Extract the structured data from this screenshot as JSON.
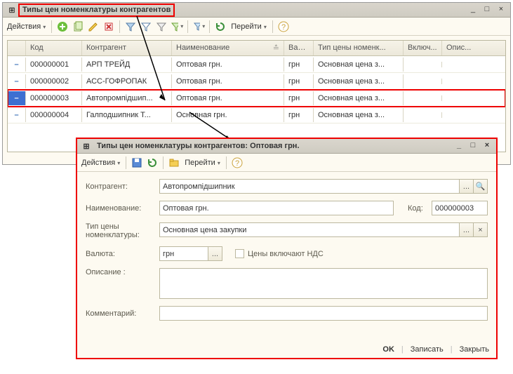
{
  "win1": {
    "title": "Типы цен номенклатуры контрагентов",
    "toolbar": {
      "actions": "Действия",
      "goto": "Перейти"
    },
    "sys": {
      "min": "_",
      "max": "□",
      "close": "×"
    },
    "cols": {
      "code": "Код",
      "counterparty": "Контрагент",
      "name": "Наименование",
      "currency": "Вал...",
      "pricetype": "Тип цены номенк...",
      "incl": "Включ...",
      "desc": "Опис..."
    },
    "rows": [
      {
        "code": "000000001",
        "counterparty": "АРП ТРЕЙД",
        "name": "Оптовая грн.",
        "currency": "грн",
        "pricetype": "Основная цена з...",
        "incl": "",
        "desc": "",
        "selected": false
      },
      {
        "code": "000000002",
        "counterparty": "АСС-ГОФРОПАК",
        "name": "Оптовая грн.",
        "currency": "грн",
        "pricetype": "Основная цена з...",
        "incl": "",
        "desc": "",
        "selected": false
      },
      {
        "code": "000000003",
        "counterparty": "Автопромпідшип...",
        "name": "Оптовая грн.",
        "currency": "грн",
        "pricetype": "Основная цена з...",
        "incl": "",
        "desc": "",
        "selected": true
      },
      {
        "code": "000000004",
        "counterparty": "Галподшипник Т...",
        "name": "Основная грн.",
        "currency": "грн",
        "pricetype": "Основная цена з...",
        "incl": "",
        "desc": "",
        "selected": false
      }
    ]
  },
  "win2": {
    "title": "Типы цен номенклатуры контрагентов: Оптовая грн.",
    "toolbar": {
      "actions": "Действия",
      "goto": "Перейти"
    },
    "sys": {
      "min": "_",
      "max": "□",
      "close": "×"
    },
    "labels": {
      "counterparty": "Контрагент:",
      "name": "Наименование:",
      "code": "Код:",
      "pricetype": "Тип цены номенклатуры:",
      "currency": "Валюта:",
      "vat": "Цены включают НДС",
      "desc": "Описание :",
      "comment": "Комментарий:"
    },
    "values": {
      "counterparty": "Автопромпідшипник",
      "name": "Оптовая грн.",
      "code": "000000003",
      "pricetype": "Основная цена закупки",
      "currency": "грн",
      "desc": "",
      "comment": ""
    },
    "footer": {
      "ok": "OK",
      "save": "Записать",
      "close": "Закрыть"
    }
  },
  "icons": {
    "grid": "⊞",
    "dots": "...",
    "search": "🔍",
    "clear": "×",
    "help": "?"
  }
}
